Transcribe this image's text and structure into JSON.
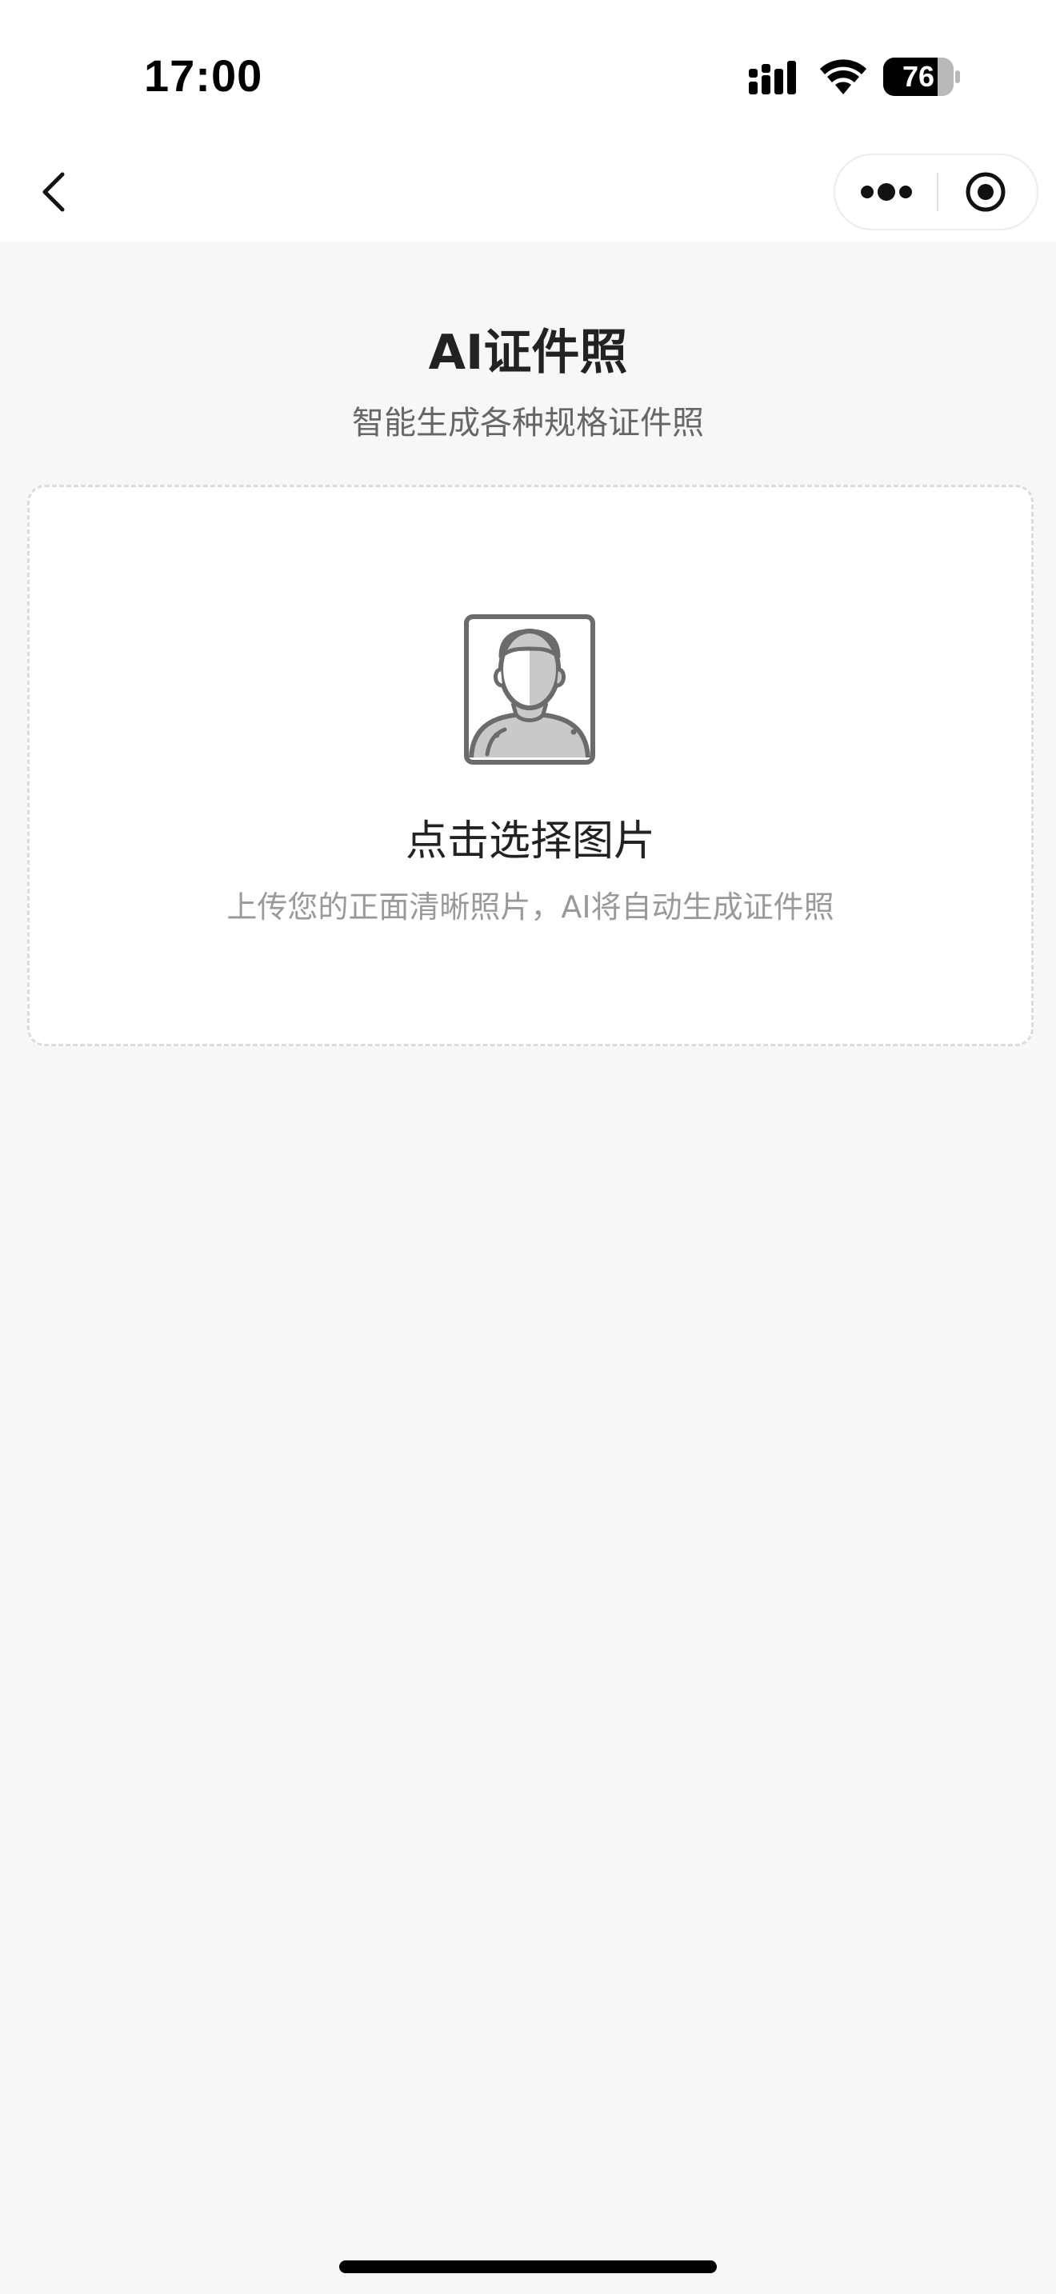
{
  "status_bar": {
    "time": "17:00",
    "battery_level": "76",
    "icons": [
      "signal-icon",
      "wifi-icon",
      "battery-icon"
    ]
  },
  "nav": {
    "icons": [
      "chevron-left-icon",
      "more-dots-icon",
      "record-target-icon"
    ]
  },
  "page": {
    "title": "AI证件照",
    "subtitle": "智能生成各种规格证件照"
  },
  "upload": {
    "icon": "portrait-photo-icon",
    "title": "点击选择图片",
    "hint": "上传您的正面清晰照片，AI将自动生成证件照"
  },
  "colors": {
    "background": "#f7f7f7",
    "card": "#ffffff",
    "title_text": "#222222",
    "subtitle_text": "#666666",
    "hint_text": "#999999",
    "card_border": "#dcdcdc"
  }
}
